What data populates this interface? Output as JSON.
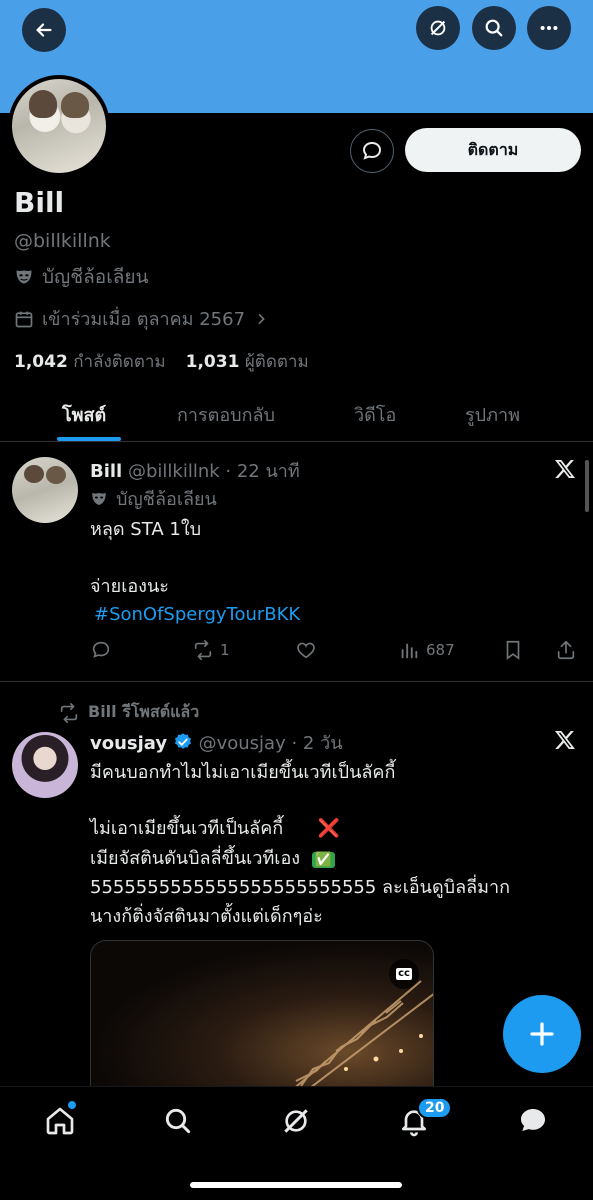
{
  "profile": {
    "name": "Bill",
    "handle": "@billkillnk",
    "parody_label": "บัญชีล้อเลียน",
    "joined": "เข้าร่วมเมื่อ ตุลาคม 2567",
    "following_count": "1,042",
    "following_label": "กำลังติดตาม",
    "followers_count": "1,031",
    "followers_label": "ผู้ติดตาม",
    "follow_button": "ติดตาม"
  },
  "tabs": [
    {
      "label": "โพสต์"
    },
    {
      "label": "การตอบกลับ"
    },
    {
      "label": "วิดีโอ"
    },
    {
      "label": "รูปภาพ"
    }
  ],
  "post1": {
    "name": "Bill",
    "handle": "@billkillnk",
    "time": "· 22 นาที",
    "parody_label": "บัญชีล้อเลียน",
    "text1": "หลุด STA 1ใบ",
    "text2": "จ่ายเองนะ",
    "hashtag": "#SonOfSpergyTourBKK",
    "reposts": "1",
    "views": "687"
  },
  "post2": {
    "repost_label": "Bill รีโพสต์แล้ว",
    "name": "vousjay",
    "handle": "@vousjay",
    "time": "· 2 วัน",
    "line1": "มีคนบอกทำไมไม่เอาเมียขึ้นเวทีเป็นลัคกี้",
    "line2": "ไม่เอาเมียขึ้นเวทีเป็นลัคกี้",
    "line2_emoji": "❌",
    "line3": "เมียจัสตินดันบิลลี่ขึ้นเวทีเอง",
    "line3_emoji": "✅",
    "line4": "5555555555555555555555555 ละเอ็นดูบิลลี่มาก",
    "line5": "นางก้ติ่งจัสตินมาตั้งแต่เด็กๆอ่ะ",
    "cc_label": "cc"
  },
  "nav": {
    "notifications_badge": "20"
  },
  "colors": {
    "accent": "#1d9bf0",
    "banner": "#4a9fe9",
    "background": "#000000"
  }
}
